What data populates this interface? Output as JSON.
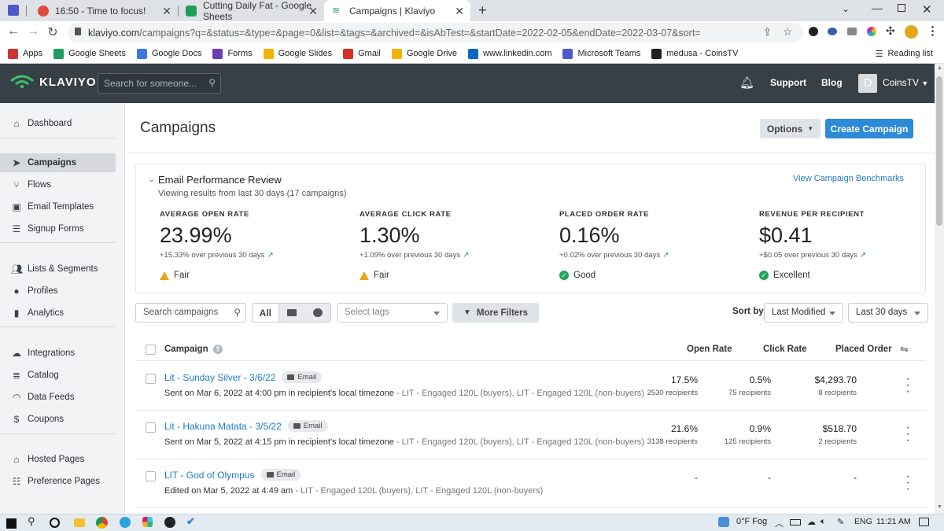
{
  "browser": {
    "tabs": [
      {
        "title": "16:50 - Time to focus!",
        "icon": "pomodoro-icon",
        "color": "#e04a3c"
      },
      {
        "title": "Cutting Daily Fat - Google Sheets",
        "icon": "sheets-icon",
        "color": "#1e9e5a"
      },
      {
        "title": "Campaigns | Klaviyo",
        "icon": "klaviyo-icon",
        "color": "#24a35a"
      }
    ],
    "url_host": "klaviyo.com",
    "url_path": "/campaigns?q=&status=&type=&page=0&list=&tags=&archived=&isAbTest=&startDate=2022-02-05&endDate=2022-03-07&sort=",
    "bookmarks": [
      {
        "label": "Apps",
        "color": "#c33"
      },
      {
        "label": "Google Sheets",
        "color": "#1e9e5a"
      },
      {
        "label": "Google Docs",
        "color": "#3a78e0"
      },
      {
        "label": "Forms",
        "color": "#6b3fb5"
      },
      {
        "label": "Google Slides",
        "color": "#f2b400"
      },
      {
        "label": "Gmail",
        "color": "#d93025"
      },
      {
        "label": "Google Drive",
        "color": "#f2b400"
      },
      {
        "label": "www.linkedin.com",
        "color": "#0a66c2"
      },
      {
        "label": "Microsoft Teams",
        "color": "#5059c9"
      },
      {
        "label": "medusa - CoinsTV",
        "color": "#222"
      }
    ],
    "reading_list": "Reading list"
  },
  "header": {
    "logo_text": "KLAVIYO",
    "search_placeholder": "Search for someone...",
    "support": "Support",
    "blog": "Blog",
    "avatar_letter": "D",
    "account": "CoinsTV"
  },
  "sidebar": {
    "groups": [
      [
        {
          "label": "Dashboard",
          "icon": "home-icon"
        }
      ],
      [
        {
          "label": "Campaigns",
          "icon": "paper-plane-icon",
          "active": true
        },
        {
          "label": "Flows",
          "icon": "flows-icon"
        },
        {
          "label": "Email Templates",
          "icon": "templates-icon"
        },
        {
          "label": "Signup Forms",
          "icon": "forms-icon"
        }
      ],
      [
        {
          "label": "Lists & Segments",
          "icon": "users-icon"
        },
        {
          "label": "Profiles",
          "icon": "profile-icon"
        },
        {
          "label": "Analytics",
          "icon": "bar-chart-icon"
        }
      ],
      [
        {
          "label": "Integrations",
          "icon": "cloud-icon"
        },
        {
          "label": "Catalog",
          "icon": "database-icon"
        },
        {
          "label": "Data Feeds",
          "icon": "rss-icon"
        },
        {
          "label": "Coupons",
          "icon": "dollar-icon"
        }
      ],
      [
        {
          "label": "Hosted Pages",
          "icon": "bank-icon"
        },
        {
          "label": "Preference Pages",
          "icon": "list-icon"
        }
      ]
    ]
  },
  "page": {
    "title": "Campaigns",
    "options": "Options",
    "create": "Create Campaign"
  },
  "performance": {
    "title": "Email Performance Review",
    "subtitle": "Viewing results from last 30 days (17 campaigns)",
    "benchmarks_link": "View Campaign Benchmarks",
    "metrics": [
      {
        "label": "AVERAGE OPEN RATE",
        "value": "23.99%",
        "change": "+15.33% over previous 30 days",
        "rating": "Fair",
        "rating_type": "warn"
      },
      {
        "label": "AVERAGE CLICK RATE",
        "value": "1.30%",
        "change": "+1.09% over previous 30 days",
        "rating": "Fair",
        "rating_type": "warn"
      },
      {
        "label": "PLACED ORDER RATE",
        "value": "0.16%",
        "change": "+0.02% over previous 30 days",
        "rating": "Good",
        "rating_type": "ok"
      },
      {
        "label": "REVENUE PER RECIPIENT",
        "value": "$0.41",
        "change": "+$0.05 over previous 30 days",
        "rating": "Excellent",
        "rating_type": "ok"
      }
    ]
  },
  "filters": {
    "search_placeholder": "Search campaigns",
    "all": "All",
    "tags_placeholder": "Select tags",
    "more_filters": "More Filters",
    "sort_by": "Sort by",
    "sort_value": "Last Modified",
    "range_value": "Last 30 days"
  },
  "table": {
    "headers": {
      "campaign": "Campaign",
      "open": "Open Rate",
      "click": "Click Rate",
      "order": "Placed Order"
    },
    "rows": [
      {
        "name": "Lit - Sunday Silver - 3/6/22",
        "badge": "Email",
        "status": "Sent on Mar 6, 2022 at 4:00 pm in recipient's local timezone",
        "lists": " - LIT - Engaged 120L (buyers), LIT - Engaged 120L (non-buyers)",
        "open": "17.5%",
        "open_sub": "2530 recipients",
        "click": "0.5%",
        "click_sub": "75 recipients",
        "order": "$4,293.70",
        "order_sub": "8 recipients"
      },
      {
        "name": "Lit - Hakuna Matata - 3/5/22",
        "badge": "Email",
        "status": "Sent on Mar 5, 2022 at 4:15 pm in recipient's local timezone",
        "lists": " - LIT - Engaged 120L (buyers), LIT - Engaged 120L (non-buyers)",
        "open": "21.6%",
        "open_sub": "3138 recipients",
        "click": "0.9%",
        "click_sub": "125 recipients",
        "order": "$518.70",
        "order_sub": "2 recipients"
      },
      {
        "name": "LIT - God of Olympus",
        "badge": "Email",
        "status": "Edited on Mar 5, 2022 at 4:49 am",
        "lists": " - LIT - Engaged 120L (buyers), LIT - Engaged 120L (non-buyers)",
        "open": "-",
        "open_sub": "",
        "click": "-",
        "click_sub": "",
        "order": "-",
        "order_sub": ""
      }
    ]
  },
  "taskbar": {
    "weather": "0°F  Fog",
    "lang": "ENG",
    "time": "11:21 AM"
  }
}
